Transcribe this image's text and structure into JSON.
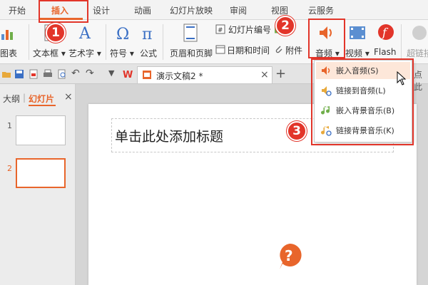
{
  "menu": {
    "tabs": [
      "开始",
      "插入",
      "设计",
      "动画",
      "幻灯片放映",
      "审阅",
      "视图",
      "云服务"
    ],
    "active": "插入"
  },
  "ribbon": {
    "chart_label": "图表",
    "textbox_label": "文本框",
    "wordart_label": "艺术字",
    "symbol_label": "符号",
    "formula_label": "公式",
    "header_footer_label": "页眉和页脚",
    "slide_number_label": "幻灯片编号",
    "datetime_label": "日期和时间",
    "attachment_label": "附件",
    "audio_label": "音频",
    "video_label": "视频",
    "flash_label": "Flash",
    "hyperlink_label": "超链接",
    "partial_right_label": "点此"
  },
  "document": {
    "tab_title": "演示文稿2 *"
  },
  "left_panel": {
    "outline_tab": "大纲",
    "slides_tab": "幻灯片",
    "slides": [
      {
        "number": "1",
        "selected": false
      },
      {
        "number": "2",
        "selected": true
      }
    ]
  },
  "slide": {
    "title_placeholder": "单击此处添加标题"
  },
  "audio_menu": {
    "items": [
      {
        "label": "嵌入音频(S)",
        "icon": "speaker-icon"
      },
      {
        "label": "链接到音频(L)",
        "icon": "link-audio-icon"
      },
      {
        "label": "嵌入背景音乐(B)",
        "icon": "music-note-icon"
      },
      {
        "label": "链接背景音乐(K)",
        "icon": "music-link-icon"
      }
    ]
  },
  "annotations": {
    "step1": "1",
    "step2": "2",
    "step3": "3"
  },
  "colors": {
    "accent": "#e8652b",
    "annotation_red": "#e2352a"
  }
}
